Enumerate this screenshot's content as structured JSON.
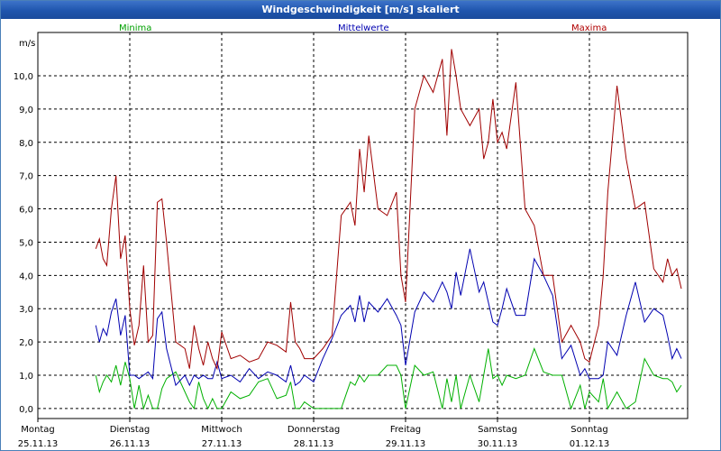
{
  "window": {
    "title": "Windgeschwindigkeit [m/s] skaliert"
  },
  "chart_data": {
    "type": "line",
    "title": "Windgeschwindigkeit [m/s] skaliert",
    "ylabel": "m/s",
    "xlabel": "",
    "legend": [
      "Minima",
      "Mittelwerte",
      "Maxima"
    ],
    "legend_position": "top",
    "grid": true,
    "ylim": [
      -0.3,
      11.3
    ],
    "y_ticks": [
      "0,0",
      "1,0",
      "2,0",
      "3,0",
      "4,0",
      "5,0",
      "6,0",
      "7,0",
      "8,0",
      "9,0",
      "10,0"
    ],
    "x_unit": "days",
    "xlim": [
      0,
      7
    ],
    "x_ticks": [
      {
        "day": "Montag",
        "date": "25.11.13"
      },
      {
        "day": "Dienstag",
        "date": "26.11.13"
      },
      {
        "day": "Mittwoch",
        "date": "27.11.13"
      },
      {
        "day": "Donnerstag",
        "date": "28.11.13"
      },
      {
        "day": "Freitag",
        "date": "29.11.13"
      },
      {
        "day": "Samstag",
        "date": "30.11.13"
      },
      {
        "day": "Sonntag",
        "date": "01.12.13"
      }
    ],
    "series": [
      {
        "name": "Minima",
        "color": "#00b000",
        "x": [
          0.63,
          0.67,
          0.71,
          0.75,
          0.8,
          0.85,
          0.9,
          0.95,
          1.0,
          1.05,
          1.1,
          1.15,
          1.2,
          1.25,
          1.3,
          1.35,
          1.4,
          1.5,
          1.6,
          1.65,
          1.7,
          1.75,
          1.8,
          1.85,
          1.9,
          1.95,
          2.0,
          2.1,
          2.2,
          2.3,
          2.4,
          2.5,
          2.6,
          2.7,
          2.75,
          2.8,
          2.85,
          2.9,
          3.0,
          3.1,
          3.2,
          3.3,
          3.4,
          3.45,
          3.5,
          3.55,
          3.6,
          3.7,
          3.8,
          3.9,
          3.95,
          4.0,
          4.1,
          4.2,
          4.3,
          4.4,
          4.45,
          4.5,
          4.55,
          4.6,
          4.7,
          4.8,
          4.85,
          4.9,
          4.95,
          5.0,
          5.05,
          5.1,
          5.2,
          5.3,
          5.4,
          5.5,
          5.6,
          5.7,
          5.8,
          5.9,
          5.95,
          6.0,
          6.1,
          6.15,
          6.2,
          6.3,
          6.4,
          6.5,
          6.6,
          6.7,
          6.8,
          6.85,
          6.9,
          6.95,
          7.0
        ],
        "values": [
          1.0,
          0.5,
          0.8,
          1.0,
          0.8,
          1.3,
          0.7,
          1.4,
          0.9,
          0.0,
          0.7,
          0.0,
          0.4,
          0.0,
          0.0,
          0.6,
          0.9,
          1.1,
          0.5,
          0.2,
          0.0,
          0.8,
          0.3,
          0.0,
          0.3,
          0.0,
          0.0,
          0.5,
          0.3,
          0.4,
          0.8,
          0.9,
          0.3,
          0.4,
          0.8,
          0.0,
          0.0,
          0.2,
          0.0,
          0.0,
          0.0,
          0.0,
          0.8,
          0.7,
          1.0,
          0.8,
          1.0,
          1.0,
          1.3,
          1.3,
          1.0,
          0.0,
          1.3,
          1.0,
          1.1,
          0.0,
          0.9,
          0.2,
          1.0,
          0.0,
          1.0,
          0.2,
          1.0,
          1.8,
          0.9,
          1.0,
          0.7,
          1.0,
          0.9,
          1.0,
          1.8,
          1.1,
          1.0,
          1.0,
          0.0,
          0.7,
          0.0,
          0.5,
          0.2,
          0.9,
          0.0,
          0.5,
          0.0,
          0.2,
          1.5,
          1.0,
          0.9,
          0.9,
          0.8,
          0.5,
          0.7
        ]
      },
      {
        "name": "Mittelwerte",
        "color": "#0000b0",
        "x": [
          0.63,
          0.67,
          0.71,
          0.75,
          0.8,
          0.85,
          0.9,
          0.95,
          1.0,
          1.05,
          1.1,
          1.15,
          1.2,
          1.25,
          1.3,
          1.35,
          1.4,
          1.5,
          1.6,
          1.65,
          1.7,
          1.75,
          1.8,
          1.85,
          1.9,
          1.95,
          2.0,
          2.1,
          2.2,
          2.3,
          2.4,
          2.5,
          2.6,
          2.7,
          2.75,
          2.8,
          2.85,
          2.9,
          3.0,
          3.1,
          3.2,
          3.3,
          3.4,
          3.45,
          3.5,
          3.55,
          3.6,
          3.7,
          3.8,
          3.9,
          3.95,
          4.0,
          4.1,
          4.2,
          4.3,
          4.4,
          4.45,
          4.5,
          4.55,
          4.6,
          4.7,
          4.8,
          4.85,
          4.9,
          4.95,
          5.0,
          5.05,
          5.1,
          5.2,
          5.3,
          5.4,
          5.5,
          5.6,
          5.7,
          5.8,
          5.9,
          5.95,
          6.0,
          6.1,
          6.15,
          6.2,
          6.3,
          6.4,
          6.5,
          6.6,
          6.7,
          6.8,
          6.85,
          6.9,
          6.95,
          7.0
        ],
        "values": [
          2.5,
          2.0,
          2.4,
          2.2,
          2.9,
          3.3,
          2.2,
          2.8,
          1.0,
          1.0,
          0.9,
          1.0,
          1.1,
          0.9,
          2.7,
          2.9,
          1.8,
          0.7,
          1.0,
          0.7,
          1.0,
          0.9,
          1.0,
          0.9,
          0.9,
          1.4,
          0.9,
          1.0,
          0.8,
          1.2,
          0.9,
          1.1,
          1.0,
          0.8,
          1.3,
          0.7,
          0.8,
          1.0,
          0.8,
          1.5,
          2.1,
          2.8,
          3.1,
          2.6,
          3.4,
          2.6,
          3.2,
          2.9,
          3.3,
          2.8,
          2.5,
          1.3,
          2.9,
          3.5,
          3.2,
          3.8,
          3.5,
          3.0,
          4.1,
          3.4,
          4.8,
          3.5,
          3.8,
          3.2,
          2.6,
          2.5,
          3.0,
          3.6,
          2.8,
          2.8,
          4.5,
          4.0,
          3.4,
          1.5,
          1.9,
          1.0,
          1.2,
          0.9,
          0.9,
          1.0,
          2.0,
          1.6,
          2.8,
          3.8,
          2.6,
          3.0,
          2.8,
          2.2,
          1.5,
          1.8,
          1.5
        ]
      },
      {
        "name": "Maxima",
        "color": "#a00000",
        "x": [
          0.63,
          0.67,
          0.71,
          0.75,
          0.8,
          0.85,
          0.9,
          0.95,
          1.0,
          1.05,
          1.1,
          1.15,
          1.2,
          1.25,
          1.3,
          1.35,
          1.4,
          1.5,
          1.6,
          1.65,
          1.7,
          1.75,
          1.8,
          1.85,
          1.9,
          1.95,
          2.0,
          2.1,
          2.2,
          2.3,
          2.4,
          2.5,
          2.6,
          2.7,
          2.75,
          2.8,
          2.85,
          2.9,
          3.0,
          3.1,
          3.2,
          3.3,
          3.4,
          3.45,
          3.5,
          3.55,
          3.6,
          3.7,
          3.8,
          3.9,
          3.95,
          4.0,
          4.1,
          4.2,
          4.3,
          4.4,
          4.45,
          4.5,
          4.55,
          4.6,
          4.7,
          4.8,
          4.85,
          4.9,
          4.95,
          5.0,
          5.05,
          5.1,
          5.2,
          5.3,
          5.4,
          5.5,
          5.6,
          5.7,
          5.8,
          5.9,
          5.95,
          6.0,
          6.1,
          6.15,
          6.2,
          6.3,
          6.4,
          6.5,
          6.6,
          6.7,
          6.8,
          6.85,
          6.9,
          6.95,
          7.0
        ],
        "values": [
          4.8,
          5.1,
          4.5,
          4.3,
          6.0,
          7.0,
          4.5,
          5.2,
          3.0,
          1.9,
          2.5,
          4.3,
          2.0,
          2.2,
          6.2,
          6.3,
          5.0,
          2.0,
          1.8,
          1.2,
          2.5,
          1.8,
          1.3,
          2.0,
          1.5,
          1.2,
          2.3,
          1.5,
          1.6,
          1.4,
          1.5,
          2.0,
          1.9,
          1.7,
          3.2,
          2.0,
          1.8,
          1.5,
          1.5,
          1.8,
          2.2,
          5.8,
          6.2,
          5.5,
          7.8,
          6.5,
          8.2,
          6.0,
          5.8,
          6.5,
          4.0,
          3.2,
          9.0,
          10.0,
          9.5,
          10.5,
          8.2,
          10.8,
          10.0,
          9.0,
          8.5,
          9.0,
          7.5,
          8.0,
          9.3,
          8.0,
          8.3,
          7.8,
          9.8,
          6.0,
          5.5,
          4.0,
          4.0,
          2.0,
          2.5,
          2.0,
          1.5,
          1.4,
          2.5,
          4.0,
          6.5,
          9.7,
          7.5,
          6.0,
          6.2,
          4.2,
          3.8,
          4.5,
          4.0,
          4.2,
          3.6
        ]
      }
    ]
  }
}
